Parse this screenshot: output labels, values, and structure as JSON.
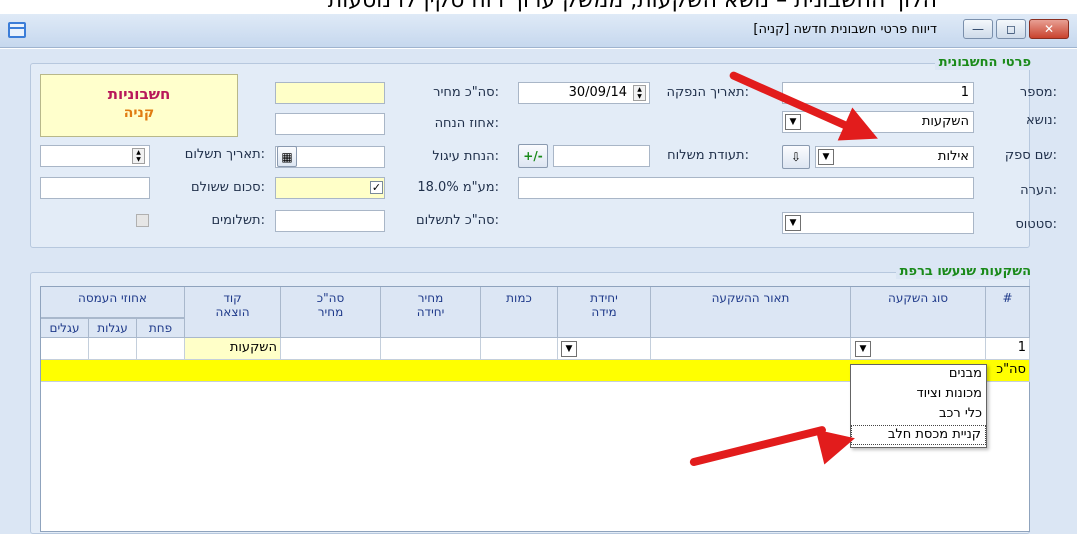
{
  "top_strip_text": "הלוך החשבונית – נושא השקעות, ממשק ערוך רוח סקין לו נוסעות",
  "window": {
    "title": "דיווח פרטי חשבונית חדשה [קניה]",
    "close": "✕",
    "maximize": "◻",
    "minimize": "—"
  },
  "invoice_group": {
    "title": "פרטי החשבונית",
    "number_label": "מספר:",
    "number_value": "1",
    "subject_label": "נושא:",
    "subject_value": "השקעות",
    "supplier_label": "שם ספק:",
    "supplier_value": "אילות",
    "note_label": "הערה:",
    "note_value": "",
    "status_label": "סטטוס:",
    "status_value": "",
    "issue_date_label": "תאריך הנפקה:",
    "issue_date_value": "30/09/14",
    "delivery_note_label": "תעודת משלוח:",
    "delivery_note_value": "",
    "plus_minus_label": "+/-",
    "price_total_label": "סה\"כ מחיר:",
    "price_total_value": "",
    "discount_pct_label": "אחוז הנחה:",
    "discount_pct_value": "",
    "rounding_discount_label": "הנחת עיגול:",
    "rounding_discount_value": "",
    "vat_label": "מע\"מ 18.0%:",
    "vat_value": "",
    "vat_checked": "✓",
    "total_payable_label": "סה\"כ לתשלום:",
    "total_payable_value": "",
    "payment_date_label": "תאריך תשלום:",
    "payment_date_value": "",
    "amount_paid_label": "סכום ששולם:",
    "amount_paid_value": "",
    "payments_label": "תשלומים:",
    "info_box": {
      "line1": "חשבוניות",
      "line2": "קניה"
    }
  },
  "investments_group": {
    "title": "השקעות שנעשו ברפת",
    "columns": {
      "num": "#",
      "type": "סוג השקעה",
      "description": "תאור ההשקעה",
      "unit": "יחידת מידה",
      "quantity": "כמות",
      "unit_price": "מחיר יחידה",
      "total_price": "סה\"כ מחיר",
      "expense_code": "קוד הוצאה",
      "depreciation": "אחוזי העמסה",
      "dep_sub": [
        "פחת",
        "עגלות",
        "עגלים"
      ]
    },
    "row": {
      "num": "1",
      "type": "",
      "description": "",
      "unit": "",
      "quantity": "",
      "unit_price": "",
      "total_price": "",
      "expense_code": "השקעות"
    },
    "total_row_label": "סה\"כ",
    "type_dropdown_options": [
      "מבנים",
      "מכונות וציוד",
      "כלי רכב",
      "קניית מכסת חלב"
    ]
  },
  "colors": {
    "accent_green": "#1a8a1a",
    "highlight_yellow": "#ffff00",
    "arrow_red": "#e21c1c"
  }
}
